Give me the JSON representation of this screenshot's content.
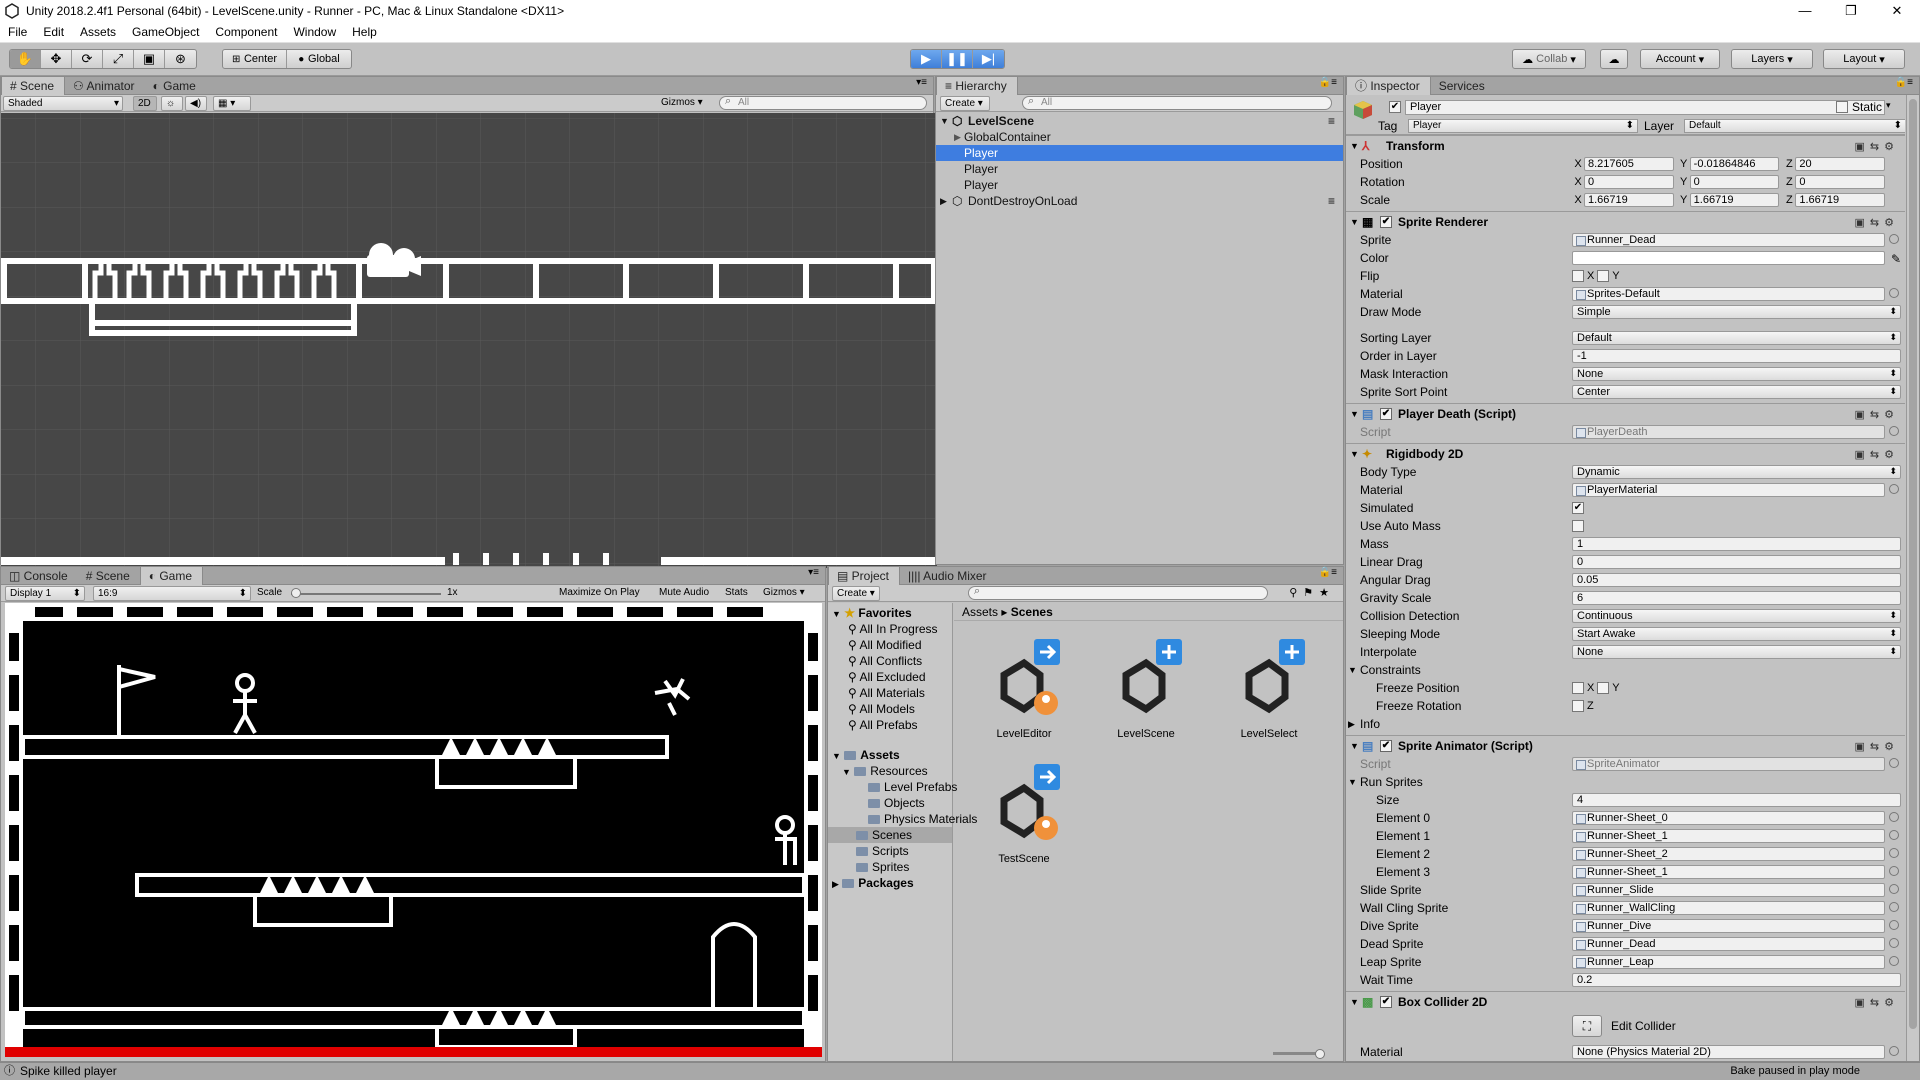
{
  "window": {
    "title": "Unity 2018.2.4f1 Personal (64bit) - LevelScene.unity - Runner - PC, Mac & Linux Standalone <DX11>"
  },
  "menu": [
    "File",
    "Edit",
    "Assets",
    "GameObject",
    "Component",
    "Window",
    "Help"
  ],
  "toolbar": {
    "pivot": "Center",
    "space": "Global",
    "collab": "Collab",
    "account": "Account",
    "layers": "Layers",
    "layout": "Layout"
  },
  "scene_panel": {
    "tabs": [
      "Scene",
      "Animator",
      "Game"
    ],
    "shading": "Shaded",
    "mode_2d": "2D",
    "gizmos": "Gizmos",
    "search_placeholder": "All"
  },
  "game_panel": {
    "tabs": [
      "Console",
      "Scene",
      "Game"
    ],
    "display": "Display 1",
    "aspect": "16:9",
    "scale_label": "Scale",
    "scale_value": "1x",
    "maximize": "Maximize On Play",
    "mute": "Mute Audio",
    "stats": "Stats",
    "gizmos": "Gizmos"
  },
  "hierarchy": {
    "tab": "Hierarchy",
    "create": "Create",
    "search_placeholder": "All",
    "scene": "LevelScene",
    "items": [
      "GlobalContainer",
      "Player",
      "Player",
      "Player"
    ],
    "dontdestroy": "DontDestroyOnLoad"
  },
  "project": {
    "tabs": [
      "Project",
      "Audio Mixer"
    ],
    "create": "Create",
    "favorites_label": "Favorites",
    "favorites": [
      "All In Progress",
      "All Modified",
      "All Conflicts",
      "All Excluded",
      "All Materials",
      "All Models",
      "All Prefabs"
    ],
    "assets_label": "Assets",
    "resources": "Resources",
    "resource_children": [
      "Level Prefabs",
      "Objects",
      "Physics Materials"
    ],
    "asset_folders": [
      "Scenes",
      "Scripts",
      "Sprites"
    ],
    "packages": "Packages",
    "breadcrumb": [
      "Assets",
      "Scenes"
    ],
    "scenes": [
      "LevelEditor",
      "LevelScene",
      "LevelSelect",
      "TestScene"
    ]
  },
  "inspector": {
    "tabs": [
      "Inspector",
      "Services"
    ],
    "object_name": "Player",
    "static_label": "Static",
    "tag_label": "Tag",
    "tag": "Player",
    "layer_label": "Layer",
    "layer": "Default",
    "transform": {
      "title": "Transform",
      "position_label": "Position",
      "position": [
        "8.217605",
        "-0.01864846",
        "20"
      ],
      "rotation_label": "Rotation",
      "rotation": [
        "0",
        "0",
        "0"
      ],
      "scale_label": "Scale",
      "scale": [
        "1.66719",
        "1.66719",
        "1.66719"
      ]
    },
    "sprite_renderer": {
      "title": "Sprite Renderer",
      "sprite_label": "Sprite",
      "sprite": "Runner_Dead",
      "color_label": "Color",
      "flip_label": "Flip",
      "material_label": "Material",
      "material": "Sprites-Default",
      "draw_mode_label": "Draw Mode",
      "draw_mode": "Simple",
      "sorting_layer_label": "Sorting Layer",
      "sorting_layer": "Default",
      "order_label": "Order in Layer",
      "order": "-1",
      "mask_label": "Mask Interaction",
      "mask": "None",
      "sort_point_label": "Sprite Sort Point",
      "sort_point": "Center"
    },
    "player_death": {
      "title": "Player Death (Script)",
      "script_label": "Script",
      "script": "PlayerDeath"
    },
    "rigidbody": {
      "title": "Rigidbody 2D",
      "body_type_label": "Body Type",
      "body_type": "Dynamic",
      "material_label": "Material",
      "material": "PlayerMaterial",
      "simulated_label": "Simulated",
      "auto_mass_label": "Use Auto Mass",
      "mass_label": "Mass",
      "mass": "1",
      "linear_drag_label": "Linear Drag",
      "linear_drag": "0",
      "angular_drag_label": "Angular Drag",
      "angular_drag": "0.05",
      "gravity_label": "Gravity Scale",
      "gravity": "6",
      "collision_label": "Collision Detection",
      "collision": "Continuous",
      "sleeping_label": "Sleeping Mode",
      "sleeping": "Start Awake",
      "interpolate_label": "Interpolate",
      "interpolate": "None",
      "constraints_label": "Constraints",
      "freeze_pos_label": "Freeze Position",
      "freeze_rot_label": "Freeze Rotation",
      "info_label": "Info"
    },
    "sprite_animator": {
      "title": "Sprite Animator (Script)",
      "script_label": "Script",
      "script": "SpriteAnimator",
      "run_sprites_label": "Run Sprites",
      "size_label": "Size",
      "size": "4",
      "elements": [
        {
          "label": "Element 0",
          "value": "Runner-Sheet_0"
        },
        {
          "label": "Element 1",
          "value": "Runner-Sheet_1"
        },
        {
          "label": "Element 2",
          "value": "Runner-Sheet_2"
        },
        {
          "label": "Element 3",
          "value": "Runner-Sheet_1"
        }
      ],
      "slide_label": "Slide Sprite",
      "slide": "Runner_Slide",
      "wallcling_label": "Wall Cling Sprite",
      "wallcling": "Runner_WallCling",
      "dive_label": "Dive Sprite",
      "dive": "Runner_Dive",
      "dead_label": "Dead Sprite",
      "dead": "Runner_Dead",
      "leap_label": "Leap Sprite",
      "leap": "Runner_Leap",
      "wait_label": "Wait Time",
      "wait": "0.2"
    },
    "box_collider": {
      "title": "Box Collider 2D",
      "edit_collider": "Edit Collider",
      "material_label": "Material",
      "material": "None (Physics Material 2D)"
    }
  },
  "status": {
    "message": "Spike killed player",
    "right": "Bake paused in play mode"
  },
  "colors": {
    "selection": "#3e7de0",
    "play_active": "#3f7fd9",
    "scene_bg": "#474747",
    "spike_red": "#e00000"
  }
}
